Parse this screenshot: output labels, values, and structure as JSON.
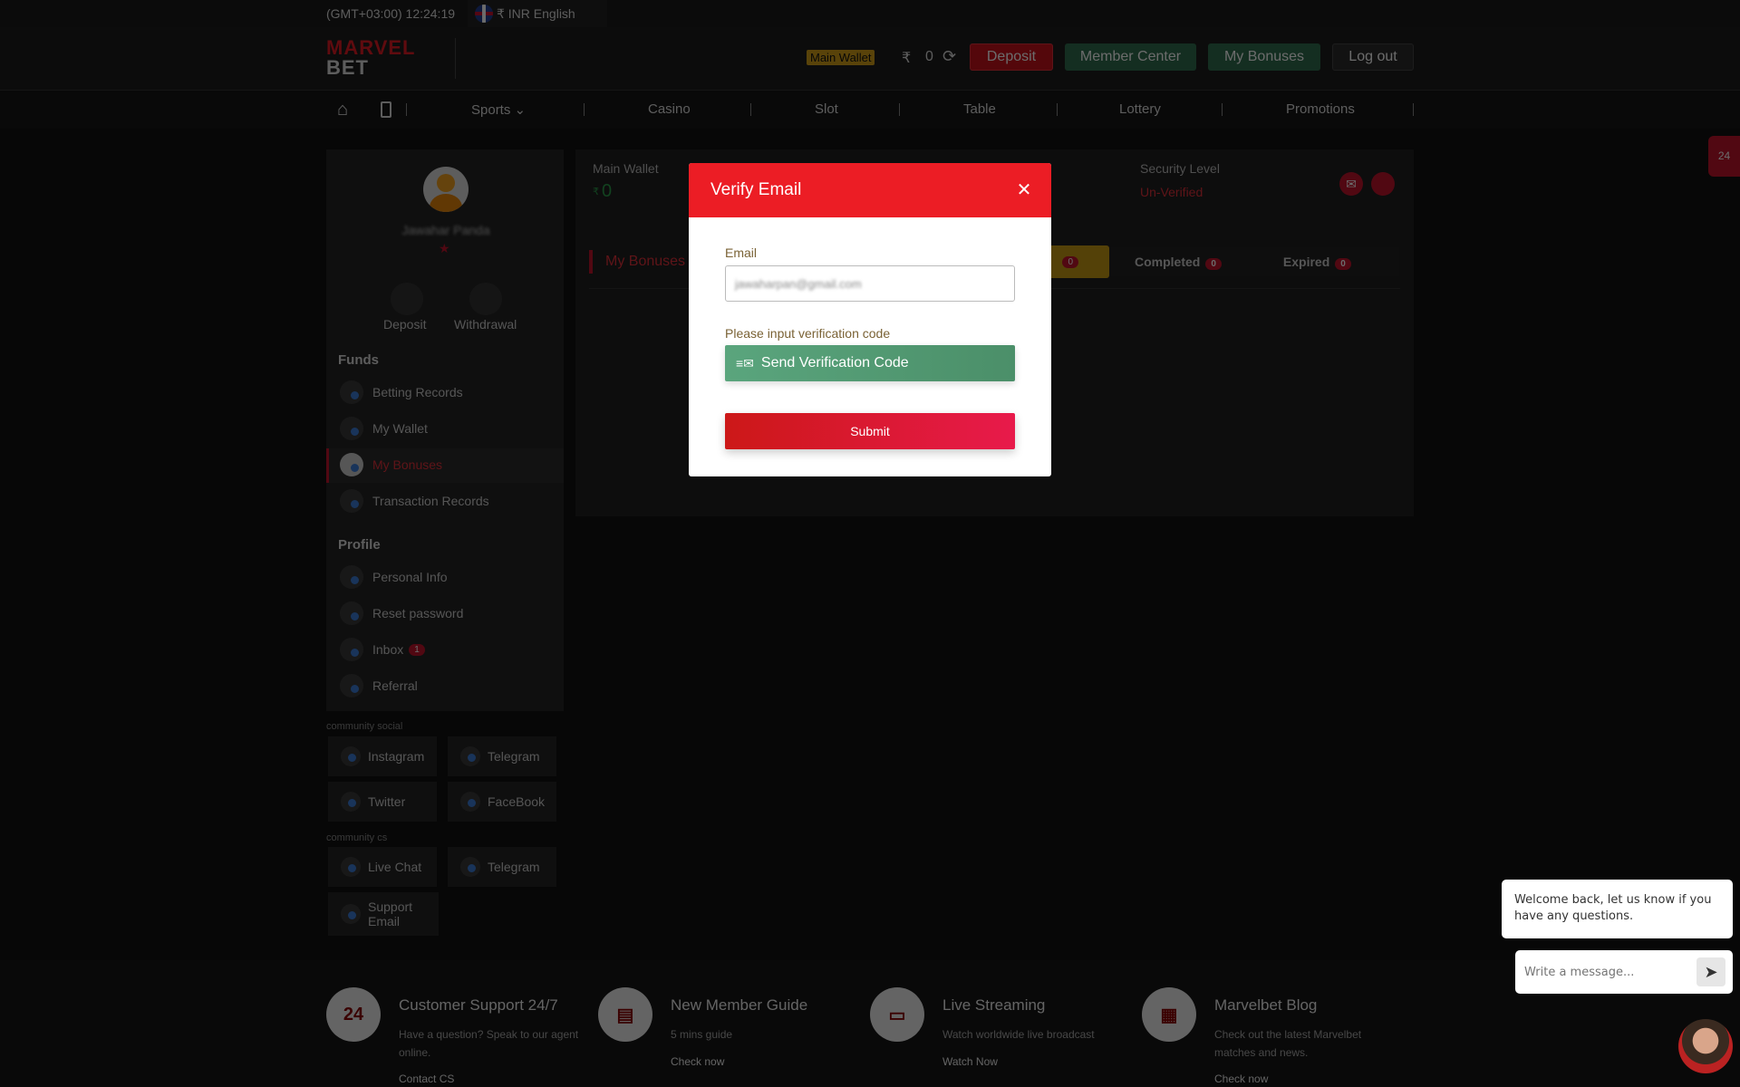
{
  "topbar": {
    "time": "(GMT+03:00) 12:24:19",
    "locale": "₹ INR English"
  },
  "header": {
    "logo_top": "MARVEL",
    "logo_bottom": "BET",
    "wallet_badge": "Main Wallet",
    "currency": "₹",
    "balance": "0",
    "deposit": "Deposit",
    "member_center": "Member Center",
    "my_bonuses": "My Bonuses",
    "logout": "Log out"
  },
  "nav": {
    "items": [
      "Sports",
      "Casino",
      "Slot",
      "Table",
      "Lottery",
      "Promotions"
    ]
  },
  "sidebar": {
    "username": "Jawahar Panda",
    "deposit": "Deposit",
    "withdrawal": "Withdrawal",
    "funds_title": "Funds",
    "funds": [
      "Betting Records",
      "My Wallet",
      "My Bonuses",
      "Transaction Records"
    ],
    "profile_title": "Profile",
    "profile": [
      "Personal Info",
      "Reset password",
      "Inbox",
      "Referral"
    ],
    "inbox_count": "1",
    "community_social": "community social",
    "social": [
      "Instagram",
      "Telegram",
      "Twitter",
      "FaceBook"
    ],
    "community_cs": "community cs",
    "cs": [
      "Live Chat",
      "Telegram",
      "Support Email"
    ]
  },
  "main": {
    "wallet_label": "Main Wallet",
    "wallet_currency": "₹",
    "wallet_value": "0",
    "security_label": "Security Level",
    "security_value": "Un-Verified",
    "bonuses_title": "My Bonuses",
    "tab_active_count": "0",
    "tabs": [
      {
        "label": "Completed",
        "count": "0"
      },
      {
        "label": "Expired",
        "count": "0"
      }
    ]
  },
  "modal": {
    "title": "Verify Email",
    "email_label": "Email",
    "email_value": "jawaharpan@gmail.com",
    "code_label": "Please input verification code",
    "send_code": "Send Verification Code",
    "submit": "Submit"
  },
  "footer": [
    {
      "icon": "24",
      "title": "Customer Support 24/7",
      "sub": "Have a question? Speak to our agent online.",
      "link": "Contact CS"
    },
    {
      "icon": "book",
      "title": "New Member Guide",
      "sub": "5 mins guide",
      "link": "Check now"
    },
    {
      "icon": "browser",
      "title": "Live Streaming",
      "sub": "Watch worldwide live broadcast",
      "link": "Watch Now"
    },
    {
      "icon": "blog",
      "title": "Marvelbet Blog",
      "sub": "Check out the latest Marvelbet matches and news.",
      "link": "Check now"
    }
  ],
  "chat": {
    "message": "Welcome back, let us know if you have any questions.",
    "placeholder": "Write a message..."
  },
  "colors": {
    "brand_red": "#ec1d25",
    "green": "#4f956c",
    "submit": "#d9142a",
    "wallet_badge": "#d4a017"
  }
}
